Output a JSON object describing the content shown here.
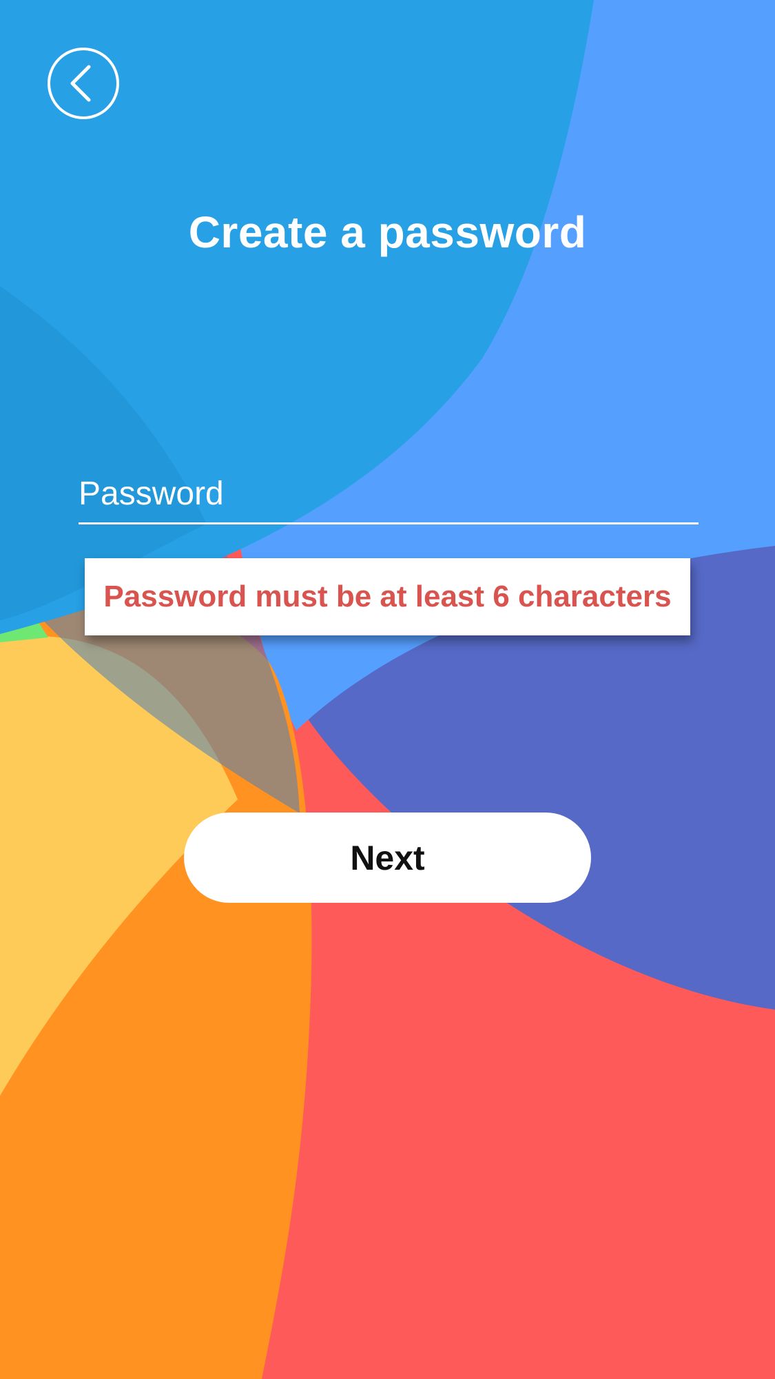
{
  "theme": {
    "top_blue": "#27a0e5",
    "light_blue": "#55a0ff",
    "indigo": "#5669c6",
    "red": "#ff5a5a",
    "orange": "#ff9220",
    "yellow": "#ffcb58",
    "green": "#6ee873",
    "text_white": "#ffffff",
    "error_red": "#d9534f"
  },
  "header": {
    "back_icon": "chevron-left-icon",
    "title": "Create a password"
  },
  "form": {
    "password_placeholder": "Password",
    "password_value": "",
    "error_message": "Password must be at least 6 characters",
    "next_label": "Next"
  }
}
